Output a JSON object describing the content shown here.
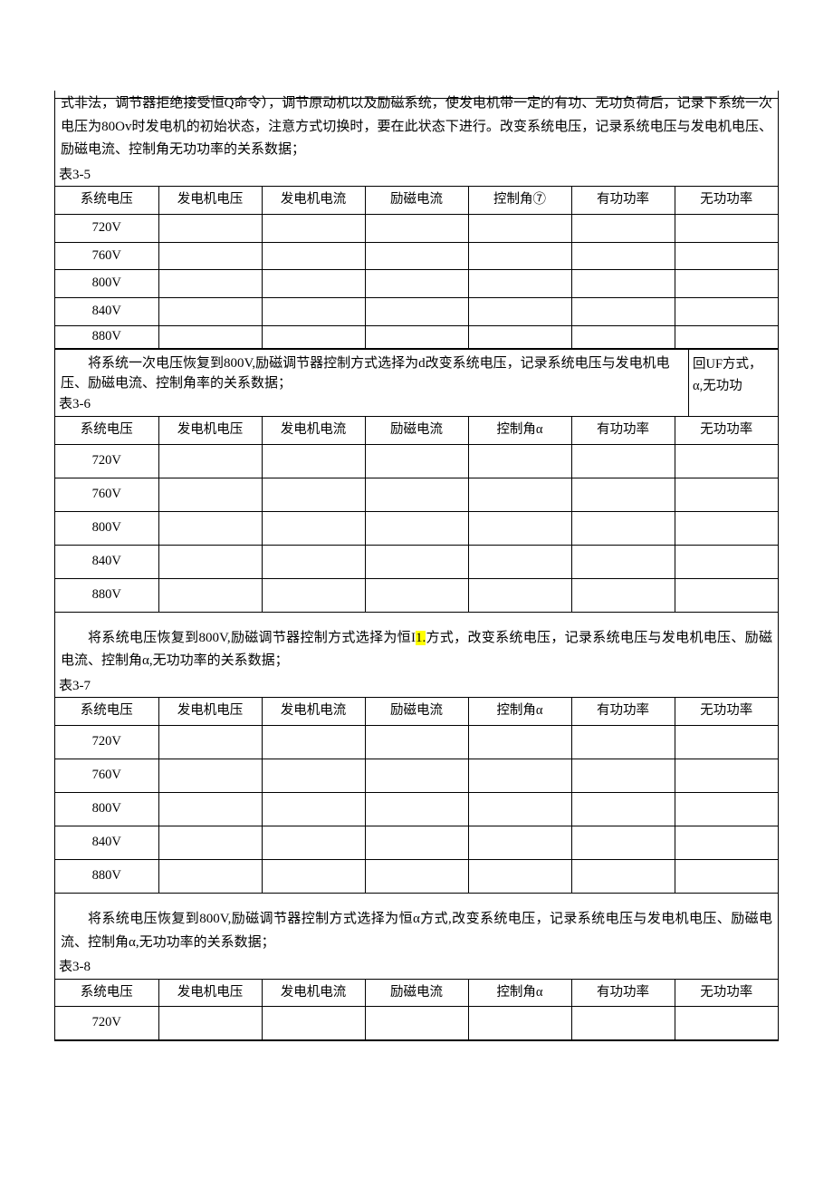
{
  "para1": "式非法，调节器拒绝接受恒Q命令），调节原动机以及励磁系统，使发电机带一定的有功、无功负荷后，记录下系统一次电压为80Ov时发电机的初始状态，注意方式切换时，要在此状态下进行。改变系统电压，记录系统电压与发电机电压、励磁电流、控制角无功功率的关系数据；",
  "table35_label": "表3-5",
  "table35_headers": [
    "系统电压",
    "发电机电压",
    "发电机电流",
    "励磁电流",
    "控制角⑦",
    "有功功率",
    "无功功率"
  ],
  "table35_rows": [
    "720V",
    "760V",
    "800V",
    "840V",
    "880V"
  ],
  "para2_main": "将系统一次电压恢复到800V,励磁调节器控制方式选择为d改变系统电压，记录系统电压与发电机电压、励磁电流、控制角率的关系数据；",
  "para2_side_l1": "回UF方式，",
  "para2_side_l2": "α,无功功",
  "table36_label": "表3-6",
  "table36_headers": [
    "系统电压",
    "发电机电压",
    "发电机电流",
    "励磁电流",
    "控制角α",
    "有功功率",
    "无功功率"
  ],
  "table36_rows": [
    "720V",
    "760V",
    "800V",
    "840V",
    "880V"
  ],
  "para3_pre": "将系统电压恢复到800V,励磁调节器控制方式选择为恒I",
  "para3_hl": "1.",
  "para3_post": "方式，改变系统电压，记录系统电压与发电机电压、励磁电流、控制角α,无功功率的关系数据；",
  "table37_label": "表3-7",
  "table37_headers": [
    "系统电压",
    "发电机电压",
    "发电机电流",
    "励磁电流",
    "控制角α",
    "有功功率",
    "无功功率"
  ],
  "table37_rows": [
    "720V",
    "760V",
    "800V",
    "840V",
    "880V"
  ],
  "para4": "将系统电压恢复到800V,励磁调节器控制方式选择为恒α方式,改变系统电压，记录系统电压与发电机电压、励磁电流、控制角α,无功功率的关系数据；",
  "table38_label": "表3-8",
  "table38_headers": [
    "系统电压",
    "发电机电压",
    "发电机电流",
    "励磁电流",
    "控制角α",
    "有功功率",
    "无功功率"
  ],
  "table38_rows": [
    "720V"
  ]
}
